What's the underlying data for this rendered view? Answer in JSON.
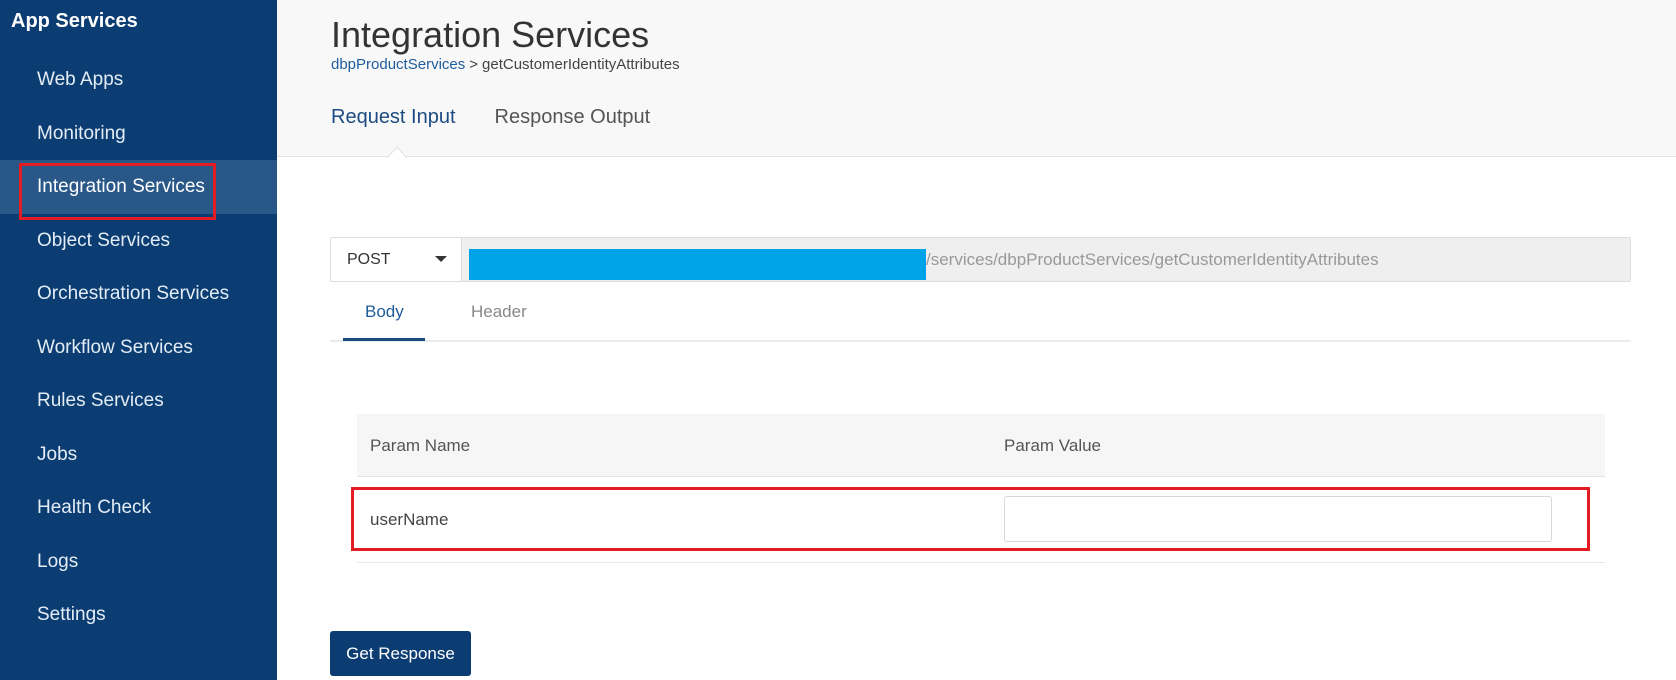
{
  "sidebar": {
    "title": "App Services",
    "items": [
      {
        "label": "Web Apps"
      },
      {
        "label": "Monitoring"
      },
      {
        "label": "Integration Services"
      },
      {
        "label": "Object Services"
      },
      {
        "label": "Orchestration Services"
      },
      {
        "label": "Workflow Services"
      },
      {
        "label": "Rules Services"
      },
      {
        "label": "Jobs"
      },
      {
        "label": "Health Check"
      },
      {
        "label": "Logs"
      },
      {
        "label": "Settings"
      }
    ],
    "active_index": 2
  },
  "header": {
    "title": "Integration Services",
    "breadcrumb": {
      "service": "dbpProductServices",
      "separator": ">",
      "operation": "getCustomerIdentityAttributes"
    },
    "tabs": [
      {
        "label": "Request Input"
      },
      {
        "label": "Response Output"
      }
    ],
    "active_tab": 0
  },
  "request": {
    "method": "POST",
    "url_suffix": "/services/dbpProductServices/getCustomerIdentityAttributes",
    "tabs": [
      {
        "label": "Body"
      },
      {
        "label": "Header"
      }
    ],
    "active_tab": 0
  },
  "params": {
    "columns": {
      "name": "Param Name",
      "value": "Param Value"
    },
    "rows": [
      {
        "name": "userName",
        "value": ""
      }
    ]
  },
  "actions": {
    "get_response": "Get Response"
  },
  "colors": {
    "sidebar": "#0b3d72",
    "highlight": "#e31b23",
    "redaction": "#00a2e8",
    "accent": "#1c4b82"
  }
}
